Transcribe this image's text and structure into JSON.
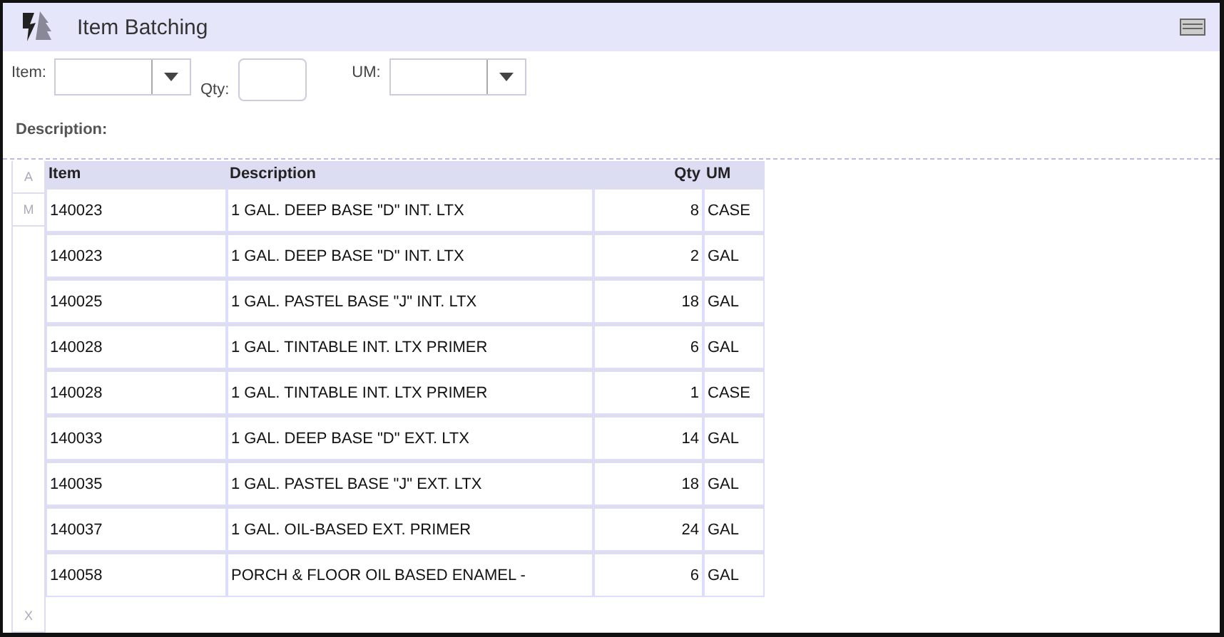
{
  "window": {
    "title": "Item Batching"
  },
  "filters": [
    {
      "label": "Item:",
      "kind": "dropdown"
    },
    {
      "label": "Qty:",
      "kind": "text"
    },
    {
      "label": "UM:",
      "kind": "dropdown"
    }
  ],
  "description_label": "Description:",
  "index_letters": {
    "top": [
      "A",
      "M"
    ],
    "bottom": [
      "X"
    ]
  },
  "table": {
    "columns": [
      {
        "label": "Item",
        "kind": "text"
      },
      {
        "label": "Description",
        "kind": "text"
      },
      {
        "label": "Qty",
        "kind": "number"
      },
      {
        "label": "UM",
        "kind": "text"
      }
    ],
    "rows": [
      [
        "140023",
        "1 GAL. DEEP BASE \"D\" INT. LTX",
        "8",
        "CASE"
      ],
      [
        "140023",
        "1 GAL. DEEP BASE \"D\" INT. LTX",
        "2",
        "GAL"
      ],
      [
        "140025",
        "1 GAL. PASTEL BASE \"J\" INT. LTX",
        "18",
        "GAL"
      ],
      [
        "140028",
        "1 GAL. TINTABLE INT. LTX PRIMER",
        "6",
        "GAL"
      ],
      [
        "140028",
        "1 GAL. TINTABLE INT. LTX PRIMER",
        "1",
        "CASE"
      ],
      [
        "140033",
        "1 GAL. DEEP BASE \"D\" EXT. LTX",
        "14",
        "GAL"
      ],
      [
        "140035",
        "1 GAL. PASTEL BASE \"J\" EXT. LTX",
        "18",
        "GAL"
      ],
      [
        "140037",
        "1 GAL. OIL-BASED EXT. PRIMER",
        "24",
        "GAL"
      ],
      [
        "140058",
        "PORCH & FLOOR OIL BASED ENAMEL -",
        "6",
        "GAL"
      ]
    ]
  }
}
